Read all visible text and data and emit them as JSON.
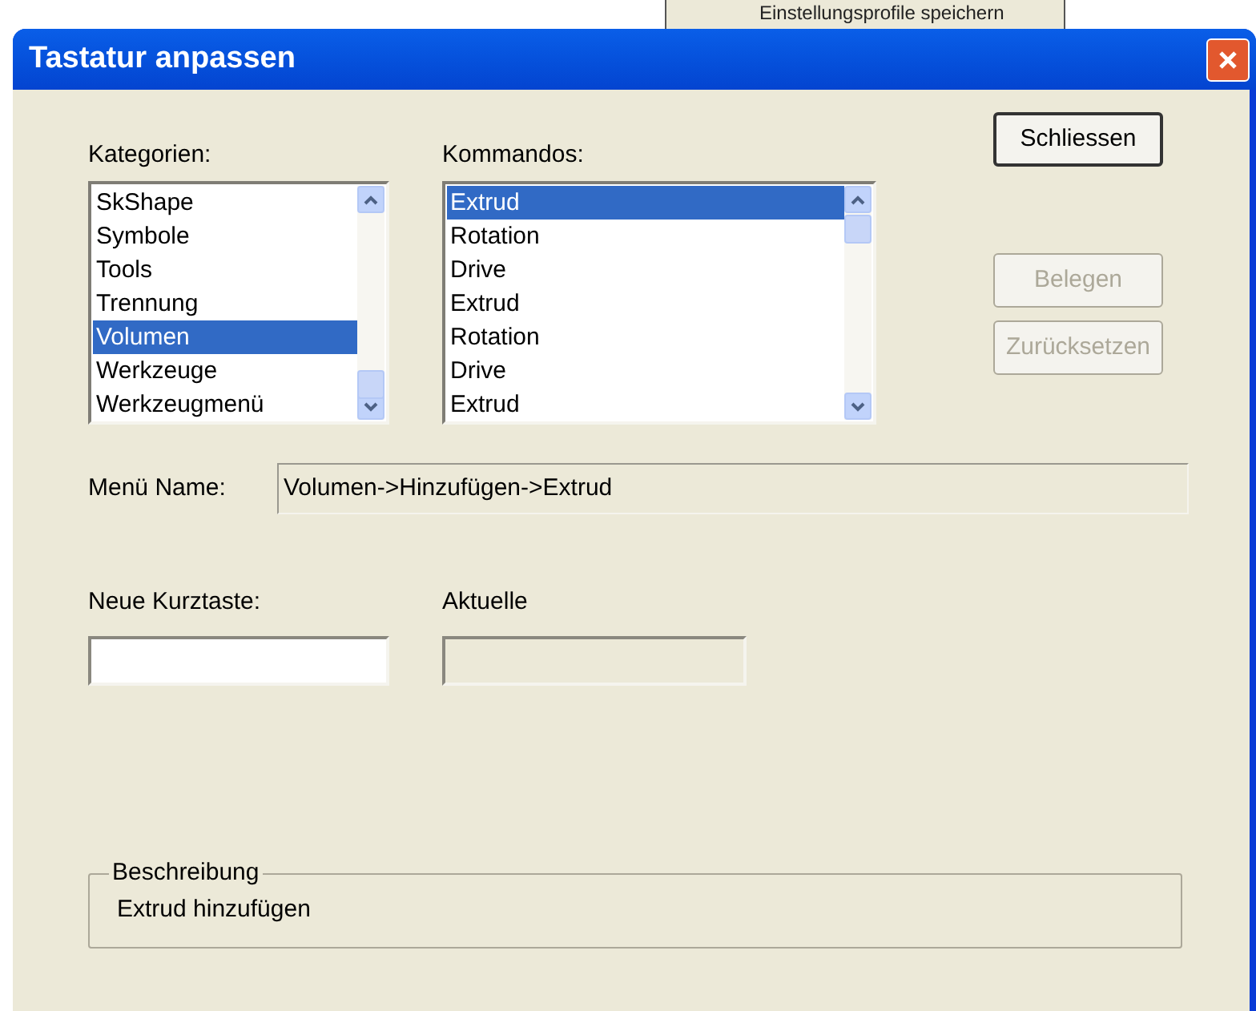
{
  "background_menu": {
    "item": "Einstellungsprofile speichern"
  },
  "window": {
    "title": "Tastatur anpassen"
  },
  "categories": {
    "label": "Kategorien:",
    "items": [
      {
        "label": "SkShape",
        "selected": false
      },
      {
        "label": "Symbole",
        "selected": false
      },
      {
        "label": "Tools",
        "selected": false
      },
      {
        "label": "Trennung",
        "selected": false
      },
      {
        "label": "Volumen",
        "selected": true
      },
      {
        "label": "Werkzeuge",
        "selected": false
      },
      {
        "label": "Werkzeugmenü",
        "selected": false
      }
    ]
  },
  "commands": {
    "label": "Kommandos:",
    "items": [
      {
        "label": "Extrud",
        "selected": true
      },
      {
        "label": "Rotation",
        "selected": false
      },
      {
        "label": "Drive",
        "selected": false
      },
      {
        "label": "Extrud",
        "selected": false
      },
      {
        "label": "Rotation",
        "selected": false
      },
      {
        "label": "Drive",
        "selected": false
      },
      {
        "label": "Extrud",
        "selected": false
      }
    ]
  },
  "buttons": [
    {
      "label": "Schliessen",
      "disabled": false,
      "default": true
    },
    {
      "label": "Belegen",
      "disabled": true,
      "default": false
    },
    {
      "label": "Zurücksetzen",
      "disabled": true,
      "default": false
    }
  ],
  "menu_name": {
    "label": "Menü Name:",
    "value": "Volumen->Hinzufügen->Extrud"
  },
  "new_shortcut": {
    "label": "Neue Kurztaste:",
    "disabled": false
  },
  "current": {
    "label": "Aktuelle",
    "disabled": true
  },
  "description": {
    "label": "Beschreibung",
    "text": "Extrud hinzufügen"
  }
}
